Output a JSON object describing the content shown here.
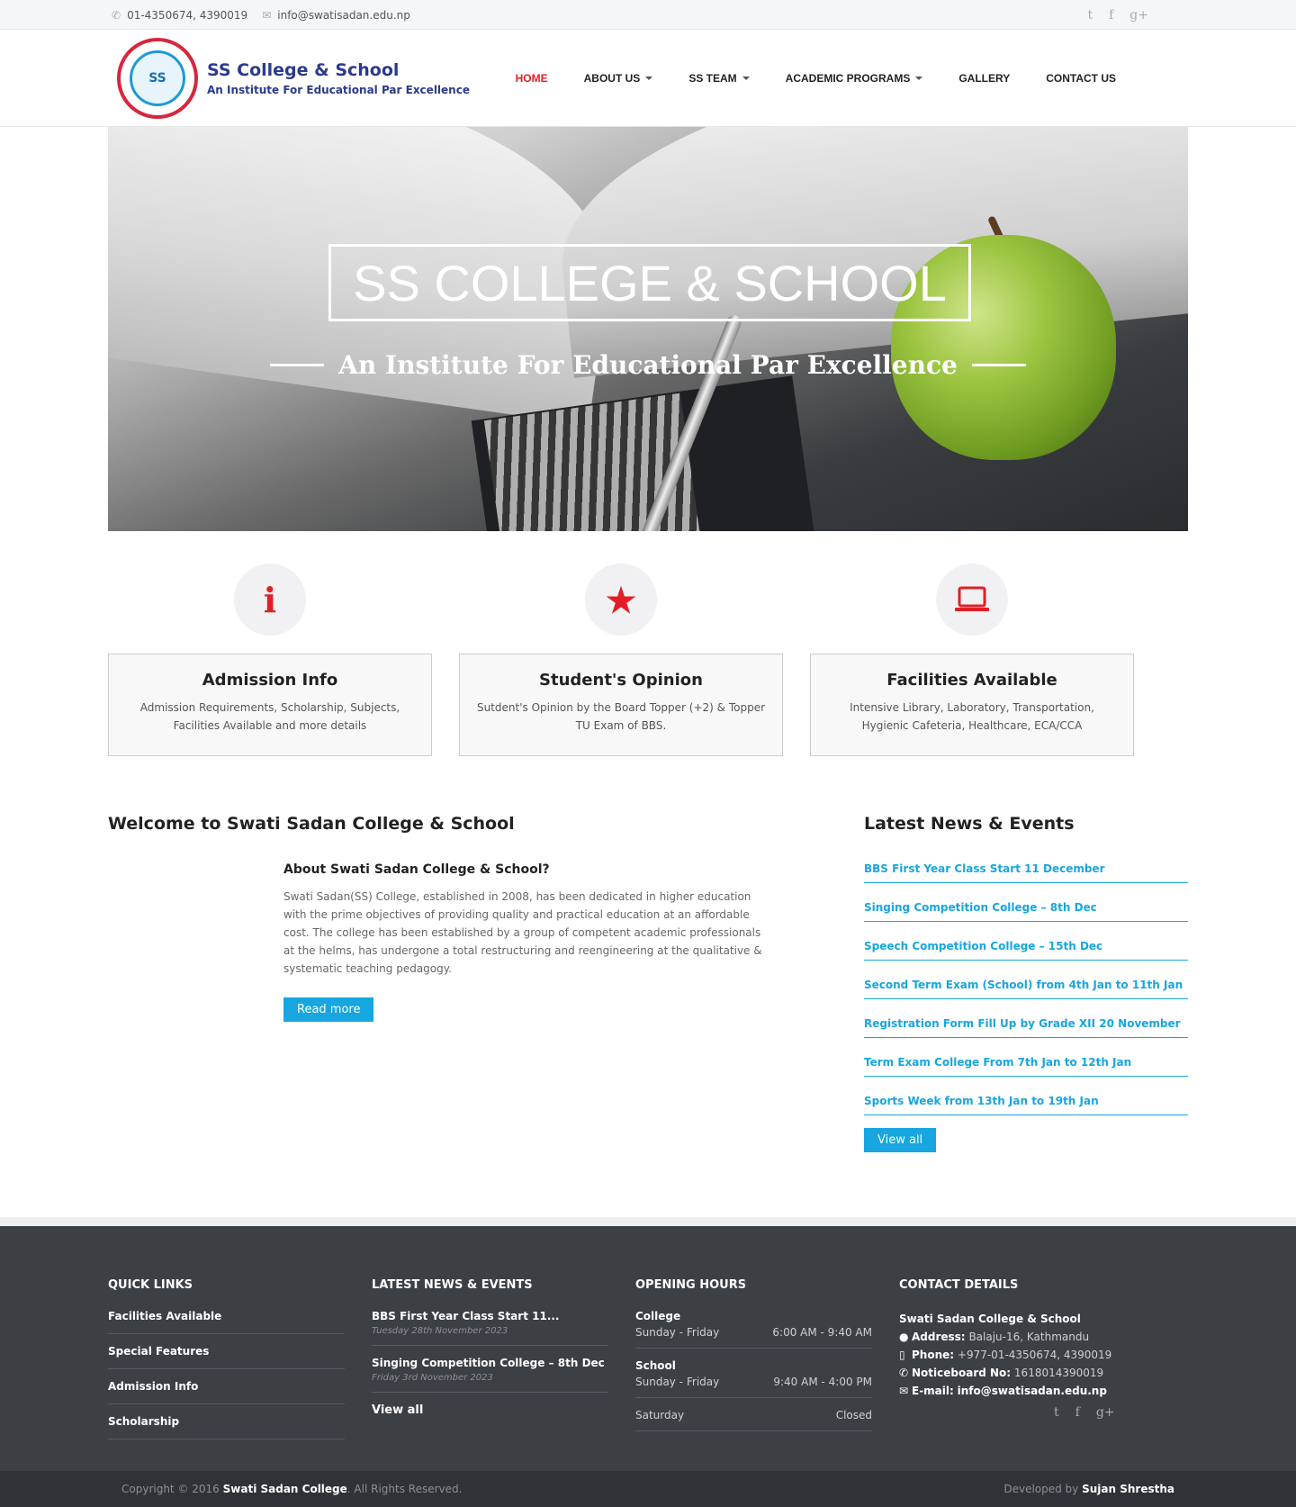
{
  "topbar": {
    "phone_icon": "phone-icon",
    "phone": "01-4350674, 4390019",
    "email_icon": "envelope-icon",
    "email": "info@swatisadan.edu.np",
    "social": [
      "twitter-icon",
      "facebook-icon",
      "google-plus-icon"
    ]
  },
  "header": {
    "logo_text": "SS",
    "name": "SS College & School",
    "tagline": "An Institute For Educational Par Excellence",
    "nav": [
      {
        "label": "HOME",
        "active": true
      },
      {
        "label": "ABOUT US",
        "dropdown": true
      },
      {
        "label": "SS TEAM",
        "dropdown": true
      },
      {
        "label": "ACADEMIC PROGRAMS",
        "dropdown": true
      },
      {
        "label": "GALLERY"
      },
      {
        "label": "CONTACT US"
      }
    ]
  },
  "hero": {
    "title": "SS COLLEGE & SCHOOL",
    "subtitle": "An Institute For Educational Par Excellence"
  },
  "features": [
    {
      "icon": "info-icon",
      "title": "Admission Info",
      "text": "Admission Requirements, Scholarship, Subjects, Facilities Available and more details"
    },
    {
      "icon": "star-icon",
      "title": "Student's Opinion",
      "text": "Sutdent's Opinion by the Board Topper (+2) & Topper TU Exam of BBS."
    },
    {
      "icon": "laptop-icon",
      "title": "Facilities Available",
      "text": "Intensive Library, Laboratory, Transportation, Hygienic Cafeteria, Healthcare, ECA/CCA"
    }
  ],
  "welcome": {
    "title": "Welcome to Swati Sadan College & School",
    "heading": "About Swati Sadan College & School?",
    "body": "Swati Sadan(SS) College, established in 2008, has been dedicated in higher education with the prime objectives of providing quality and practical education at an affordable cost. The college has been established by a group of competent academic professionals at the helms, has undergone a total restructuring and reengineering at the qualitative & systematic teaching pedagogy.",
    "button": "Read more"
  },
  "news": {
    "title": "Latest News & Events",
    "items": [
      "BBS First Year Class Start 11 December",
      "Singing Competition College – 8th Dec",
      "Speech Competition College – 15th Dec",
      "Second Term Exam (School) from 4th Jan to 11th Jan",
      "Registration Form Fill Up by Grade XII 20 November",
      "Term Exam College From 7th Jan to 12th Jan",
      "Sports Week from 13th Jan to 19th Jan"
    ],
    "button": "View all"
  },
  "footer": {
    "quick_links": {
      "title": "QUICK LINKS",
      "items": [
        "Facilities Available",
        "Special Features",
        "Admission Info",
        "Scholarship"
      ]
    },
    "news": {
      "title": "LATEST NEWS & EVENTS",
      "items": [
        {
          "title": "BBS First Year Class Start 11...",
          "date": "Tuesday 28th November 2023"
        },
        {
          "title": "Singing Competition College – 8th Dec",
          "date": "Friday 3rd November 2023"
        }
      ],
      "view_all": "View all"
    },
    "hours": {
      "title": "OPENING HOURS",
      "college": {
        "label": "College",
        "days": "Sunday - Friday",
        "time": "6:00 AM - 9:40 AM"
      },
      "school": {
        "label": "School",
        "days": "Sunday - Friday",
        "time": "9:40 AM - 4:00 PM"
      },
      "saturday": {
        "days": "Saturday",
        "time": "Closed"
      }
    },
    "contact": {
      "title": "CONTACT DETAILS",
      "org": "Swati Sadan College & School",
      "address_label": "Address:",
      "address": "Balaju-16, Kathmandu",
      "phone_label": "Phone:",
      "phone": "+977-01-4350674, 4390019",
      "notice_label": "Noticeboard No:",
      "notice": "1618014390019",
      "email_label": "E-mail:",
      "email": "info@swatisadan.edu.np",
      "social": [
        "twitter-icon",
        "facebook-icon",
        "google-plus-icon"
      ]
    }
  },
  "bottom": {
    "copyright_prefix": "Copyright © 2016",
    "college": "Swati Sadan College",
    "copyright_suffix": ". All Rights Reserved.",
    "dev_prefix": "Developed by",
    "developer": "Sujan Shrestha"
  }
}
